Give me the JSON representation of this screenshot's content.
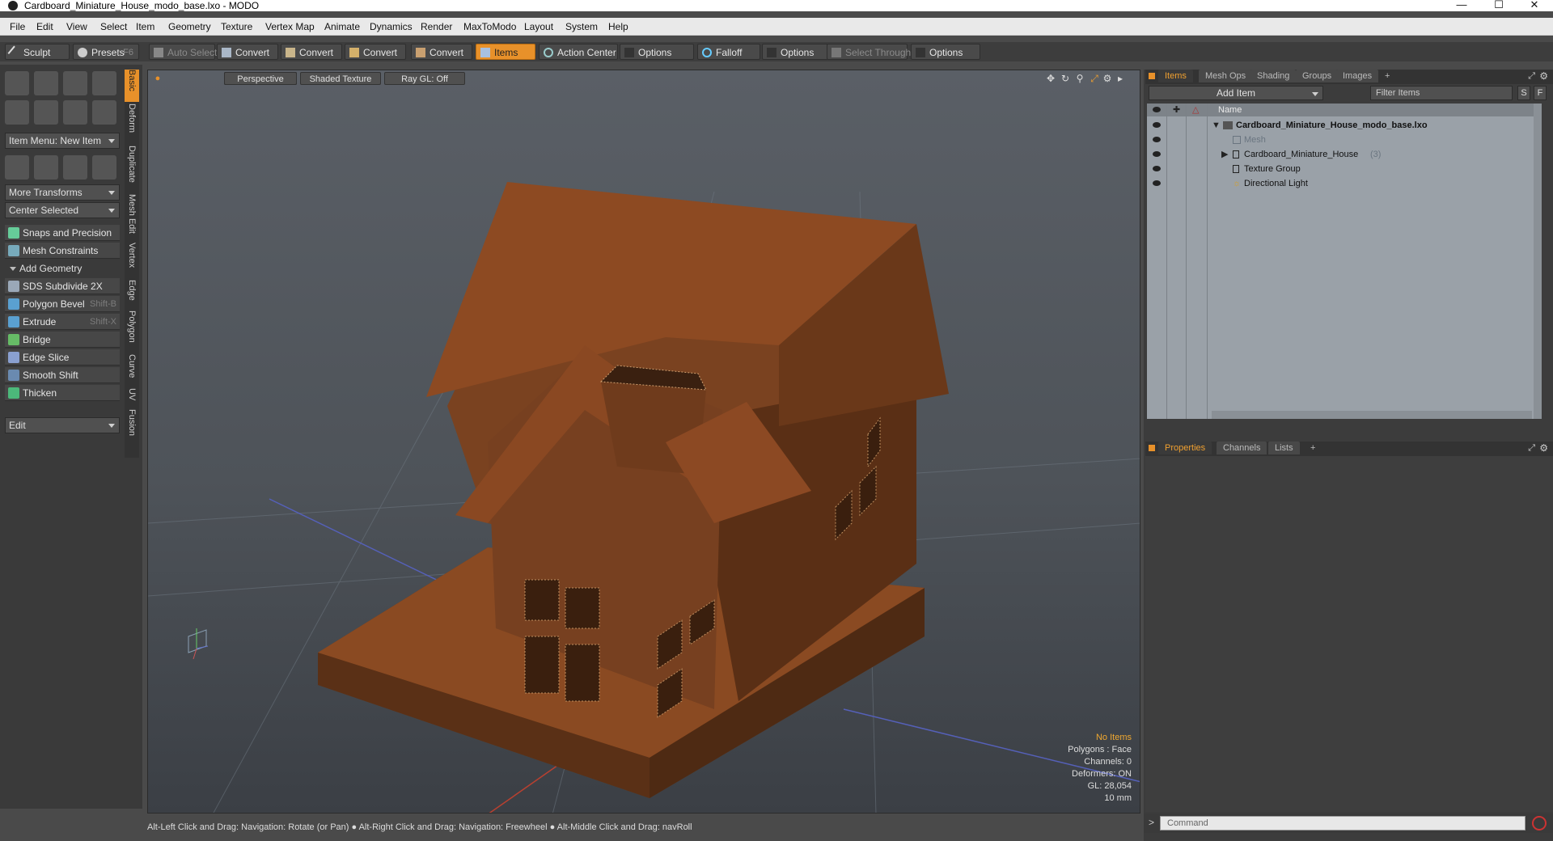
{
  "window": {
    "title": "Cardboard_Miniature_House_modo_base.lxo - MODO"
  },
  "menu": [
    "File",
    "Edit",
    "View",
    "Select",
    "Item",
    "Geometry",
    "Texture",
    "Vertex Map",
    "Animate",
    "Dynamics",
    "Render",
    "MaxToModo",
    "Layout",
    "System",
    "Help"
  ],
  "toolbar": {
    "sculpt": "Sculpt",
    "presets": "Presets",
    "presets_shortcut": "F6",
    "auto_select": "Auto Select",
    "convert": "Convert",
    "items": "Items",
    "action_center": "Action Center",
    "options": "Options",
    "falloff": "Falloff",
    "select_through": "Select Through"
  },
  "left": {
    "item_menu": "Item Menu: New Item",
    "more_transforms": "More Transforms",
    "center_selected": "Center Selected",
    "snaps": "Snaps and Precision",
    "mesh_constraints": "Mesh Constraints",
    "add_geometry": "Add Geometry",
    "tools": [
      {
        "label": "SDS Subdivide 2X",
        "shortcut": "",
        "color": "#9aa8b8"
      },
      {
        "label": "Polygon Bevel",
        "shortcut": "Shift-B",
        "color": "#5aa0d0"
      },
      {
        "label": "Extrude",
        "shortcut": "Shift-X",
        "color": "#5aa0d0"
      },
      {
        "label": "Bridge",
        "shortcut": "",
        "color": "#66bb66"
      },
      {
        "label": "Edge Slice",
        "shortcut": "",
        "color": "#8aa0d0"
      },
      {
        "label": "Smooth Shift",
        "shortcut": "",
        "color": "#6a8ab0"
      },
      {
        "label": "Thicken",
        "shortcut": "",
        "color": "#4cb87a"
      }
    ],
    "edit": "Edit",
    "vtabs": [
      "Basic",
      "Deform",
      "Duplicate",
      "Mesh Edit",
      "Vertex",
      "Edge",
      "Polygon",
      "Curve",
      "UV",
      "Fusion"
    ]
  },
  "viewport": {
    "view": "Perspective",
    "shading": "Shaded Texture",
    "raygl": "Ray GL: Off",
    "info": {
      "selection": "No Items",
      "polygons": "Polygons : Face",
      "channels": "Channels: 0",
      "deformers": "Deformers: ON",
      "gl": "GL: 28,054",
      "scale": "10 mm"
    }
  },
  "status": "Alt-Left Click and Drag: Navigation: Rotate (or Pan) ● Alt-Right Click and Drag: Navigation: Freewheel ● Alt-Middle Click and Drag: navRoll",
  "right": {
    "tabs": [
      "Items",
      "Mesh Ops",
      "Shading",
      "Groups",
      "Images",
      "+"
    ],
    "add_item": "Add Item",
    "filter_items": "Filter Items",
    "filter_s": "S",
    "filter_f": "F",
    "name_header": "Name",
    "tree": [
      {
        "label": "Cardboard_Miniature_House_modo_base.lxo",
        "count": "",
        "bold": true,
        "dim": false
      },
      {
        "label": "Mesh",
        "count": "",
        "bold": false,
        "dim": true
      },
      {
        "label": "Cardboard_Miniature_House",
        "count": "(3)",
        "bold": false,
        "dim": false
      },
      {
        "label": "Texture Group",
        "count": "",
        "bold": false,
        "dim": false
      },
      {
        "label": "Directional Light",
        "count": "",
        "bold": false,
        "dim": false
      }
    ],
    "bottom_tabs": [
      "Properties",
      "Channels",
      "Lists",
      "+"
    ],
    "command_placeholder": "Command"
  }
}
